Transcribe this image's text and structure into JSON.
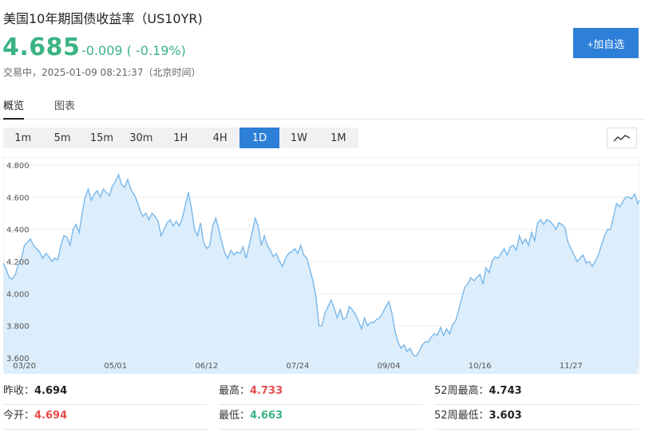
{
  "header": {
    "title": "美国10年期国债收益率（US10YR)",
    "price": "4.685",
    "change": "-0.009 ( -0.19%)",
    "status": "交易中，2025-01-09 08:21:37（北京时间）",
    "add_label": "+加自选"
  },
  "tabs": [
    {
      "label": "概览",
      "active": true
    },
    {
      "label": "图表",
      "active": false
    }
  ],
  "periods": [
    "1m",
    "5m",
    "15m",
    "30m",
    "1H",
    "4H",
    "1D",
    "1W",
    "1M"
  ],
  "active_period": "1D",
  "colors": {
    "up": "#e84d4d",
    "down": "#3bb383",
    "accent": "#2d7fd8",
    "line": "#7ab8ea",
    "fill": "#dcedfb"
  },
  "icons": {
    "chart_type": "line-chart-icon"
  },
  "stats": [
    [
      {
        "label": "昨收：",
        "value": "4.694",
        "color": "dark"
      },
      {
        "label": "最高：",
        "value": "4.733",
        "color": "red"
      },
      {
        "label": "52周最高：",
        "value": "4.743",
        "color": "dark"
      }
    ],
    [
      {
        "label": "今开：",
        "value": "4.694",
        "color": "red"
      },
      {
        "label": "最低：",
        "value": "4.663",
        "color": "green"
      },
      {
        "label": "52周最低：",
        "value": "3.603",
        "color": "dark"
      }
    ]
  ],
  "chart_data": {
    "type": "area",
    "ylim": [
      3.6,
      4.8
    ],
    "yticks": [
      "4.800",
      "4.600",
      "4.400",
      "4.200",
      "4.000",
      "3.800",
      "3.600"
    ],
    "xticks": [
      {
        "label": "03/20",
        "at": 7
      },
      {
        "label": "05/01",
        "at": 37
      },
      {
        "label": "06/12",
        "at": 67
      },
      {
        "label": "07/24",
        "at": 97
      },
      {
        "label": "09/04",
        "at": 127
      },
      {
        "label": "10/16",
        "at": 157
      },
      {
        "label": "11/27",
        "at": 187
      }
    ],
    "x_count": 210,
    "values": [
      4.19,
      4.15,
      4.1,
      4.09,
      4.12,
      4.18,
      4.22,
      4.3,
      4.32,
      4.34,
      4.3,
      4.28,
      4.26,
      4.22,
      4.25,
      4.23,
      4.2,
      4.22,
      4.21,
      4.3,
      4.36,
      4.35,
      4.3,
      4.4,
      4.43,
      4.38,
      4.5,
      4.6,
      4.65,
      4.58,
      4.62,
      4.64,
      4.6,
      4.65,
      4.63,
      4.61,
      4.67,
      4.7,
      4.74,
      4.68,
      4.66,
      4.71,
      4.65,
      4.62,
      4.58,
      4.52,
      4.48,
      4.5,
      4.46,
      4.5,
      4.48,
      4.45,
      4.36,
      4.4,
      4.44,
      4.46,
      4.42,
      4.45,
      4.42,
      4.47,
      4.55,
      4.63,
      4.53,
      4.4,
      4.36,
      4.44,
      4.32,
      4.28,
      4.3,
      4.42,
      4.47,
      4.4,
      4.32,
      4.25,
      4.22,
      4.27,
      4.24,
      4.26,
      4.25,
      4.29,
      4.22,
      4.3,
      4.38,
      4.47,
      4.42,
      4.3,
      4.36,
      4.3,
      4.27,
      4.23,
      4.25,
      4.2,
      4.17,
      4.22,
      4.25,
      4.26,
      4.28,
      4.25,
      4.3,
      4.24,
      4.22,
      4.15,
      4.08,
      3.98,
      3.8,
      3.8,
      3.88,
      3.92,
      3.96,
      3.91,
      3.85,
      3.9,
      3.84,
      3.85,
      3.92,
      3.9,
      3.87,
      3.83,
      3.78,
      3.85,
      3.8,
      3.82,
      3.82,
      3.84,
      3.85,
      3.88,
      3.92,
      3.95,
      3.88,
      3.77,
      3.7,
      3.66,
      3.68,
      3.64,
      3.66,
      3.62,
      3.61,
      3.64,
      3.68,
      3.7,
      3.7,
      3.73,
      3.75,
      3.74,
      3.79,
      3.74,
      3.78,
      3.75,
      3.81,
      3.83,
      3.9,
      3.97,
      4.04,
      4.06,
      4.1,
      4.08,
      4.1,
      4.12,
      4.06,
      4.16,
      4.13,
      4.2,
      4.23,
      4.22,
      4.25,
      4.28,
      4.24,
      4.29,
      4.3,
      4.27,
      4.36,
      4.31,
      4.34,
      4.3,
      4.38,
      4.33,
      4.44,
      4.46,
      4.43,
      4.46,
      4.45,
      4.43,
      4.4,
      4.44,
      4.43,
      4.41,
      4.32,
      4.28,
      4.24,
      4.2,
      4.22,
      4.24,
      4.19,
      4.2,
      4.17,
      4.2,
      4.24,
      4.3,
      4.36,
      4.4,
      4.4,
      4.48,
      4.56,
      4.54,
      4.57,
      4.6,
      4.6,
      4.59,
      4.62,
      4.56,
      4.6,
      4.58,
      4.63,
      4.66,
      4.7,
      4.7
    ]
  }
}
